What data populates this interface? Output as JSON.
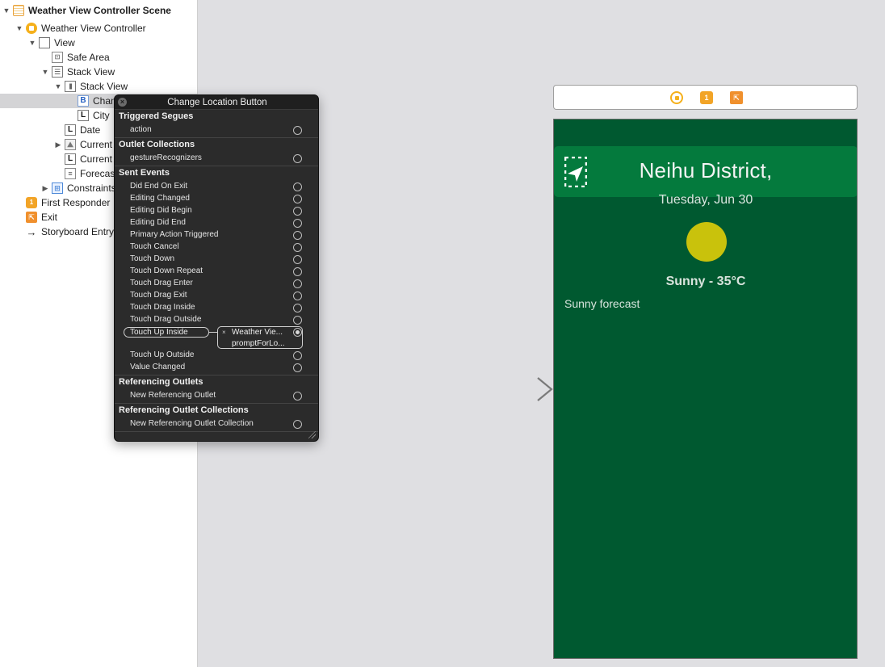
{
  "outline": {
    "rows": [
      {
        "text": "Weather View Controller Scene",
        "icon": "scene-icon",
        "disclosure": "expanded"
      },
      {
        "text": "Weather View Controller",
        "icon": "view-controller-icon",
        "disclosure": "expanded"
      },
      {
        "text": "View",
        "icon": "view-icon",
        "disclosure": "expanded"
      },
      {
        "text": "Safe Area",
        "icon": "safe-area-icon",
        "disclosure": "none"
      },
      {
        "text": "Stack View",
        "icon": "vertical-stack-icon",
        "disclosure": "expanded"
      },
      {
        "text": "Stack View",
        "icon": "horizontal-stack-icon",
        "disclosure": "expanded"
      },
      {
        "text": "Chan",
        "icon": "button-icon",
        "disclosure": "none",
        "selected": true
      },
      {
        "text": "City",
        "icon": "label-icon",
        "disclosure": "none"
      },
      {
        "text": "Date",
        "icon": "label-icon",
        "disclosure": "none"
      },
      {
        "text": "Current",
        "icon": "image-view-icon",
        "disclosure": "collapsed"
      },
      {
        "text": "Current",
        "icon": "label-icon",
        "disclosure": "none"
      },
      {
        "text": "Forecas",
        "icon": "text-view-icon",
        "disclosure": "none"
      },
      {
        "text": "Constraints",
        "icon": "constraints-icon",
        "disclosure": "collapsed"
      },
      {
        "text": "First Responder",
        "icon": "first-responder-icon",
        "disclosure": "none"
      },
      {
        "text": "Exit",
        "icon": "exit-icon",
        "disclosure": "none"
      },
      {
        "text": "Storyboard Entry",
        "icon": "entry-arrow-icon",
        "disclosure": "none"
      }
    ],
    "icon_glyphs": {
      "safe": "⊡",
      "vstack": "☰",
      "hstack": "|||",
      "label": "L",
      "button": "B",
      "image": "⛰",
      "text": "≡",
      "cons": "⊞",
      "fr": "1",
      "exit": "⇱",
      "arrow": "→"
    }
  },
  "popover": {
    "title": "Change Location Button",
    "close_glyph": "×",
    "sections": {
      "triggered_segues": {
        "title": "Triggered Segues",
        "items": [
          "action"
        ]
      },
      "outlet_collections": {
        "title": "Outlet Collections",
        "items": [
          "gestureRecognizers"
        ]
      },
      "sent_events": {
        "title": "Sent Events",
        "items": [
          "Did End On Exit",
          "Editing Changed",
          "Editing Did Begin",
          "Editing Did End",
          "Primary Action Triggered",
          "Touch Cancel",
          "Touch Down",
          "Touch Down Repeat",
          "Touch Drag Enter",
          "Touch Drag Exit",
          "Touch Drag Inside",
          "Touch Drag Outside"
        ],
        "connected_event": "Touch Up Inside",
        "connection_remove_glyph": "×",
        "connection_target": "Weather Vie...",
        "connection_action": "promptForLo...",
        "items_after": [
          "Touch Up Outside",
          "Value Changed"
        ]
      },
      "referencing_outlets": {
        "title": "Referencing Outlets",
        "items": [
          "New Referencing Outlet"
        ]
      },
      "referencing_outlet_collections": {
        "title": "Referencing Outlet Collections",
        "items": [
          "New Referencing Outlet Collection"
        ]
      }
    }
  },
  "scene_bar": {
    "icons": [
      "view-controller-icon",
      "first-responder-icon",
      "exit-icon"
    ],
    "fr_glyph": "1",
    "exit_glyph": "⇱"
  },
  "device": {
    "city": "Neihu District,",
    "date": "Tuesday, Jun 30",
    "current": "Sunny - 35°C",
    "forecast": "Sunny forecast",
    "colors": {
      "background": "#005930",
      "header": "#047a3d",
      "sun": "#c9c20c"
    }
  }
}
